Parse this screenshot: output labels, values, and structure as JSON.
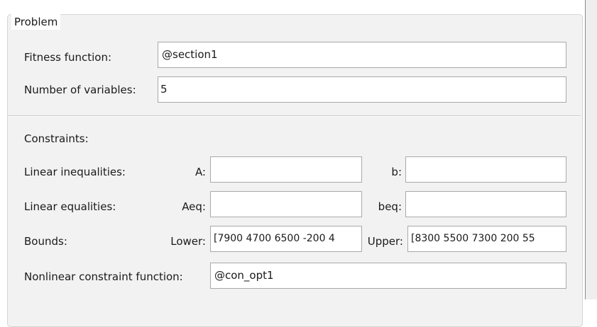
{
  "group_title": "Problem",
  "fitness": {
    "label": "Fitness function:",
    "value": "@section1"
  },
  "num_vars": {
    "label": "Number of variables:",
    "value": "5"
  },
  "constraints": {
    "heading": "Constraints:",
    "linear_ineq": {
      "label": "Linear inequalities:",
      "a_label": "A:",
      "a_value": "",
      "b_label": "b:",
      "b_value": ""
    },
    "linear_eq": {
      "label": "Linear equalities:",
      "aeq_label": "Aeq:",
      "aeq_value": "",
      "beq_label": "beq:",
      "beq_value": ""
    },
    "bounds": {
      "label": "Bounds:",
      "lower_label": "Lower:",
      "lower_value": "[7900 4700 6500 -200 4",
      "upper_label": "Upper:",
      "upper_value": "[8300 5500 7300 200 55"
    },
    "nonlinear": {
      "label": "Nonlinear constraint function:",
      "value": "@con_opt1"
    }
  }
}
